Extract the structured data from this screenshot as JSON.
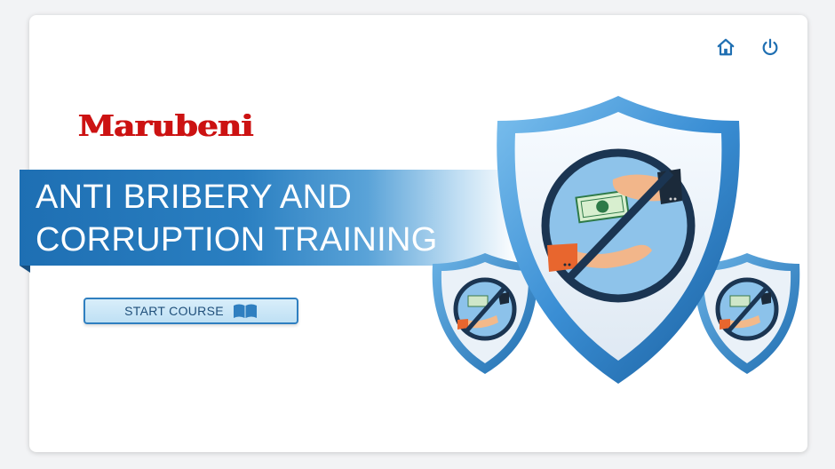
{
  "brand": {
    "name": "Marubeni",
    "color": "#cc1212"
  },
  "header": {
    "icons": [
      {
        "name": "home-icon"
      },
      {
        "name": "power-icon"
      }
    ]
  },
  "banner": {
    "title_line1": "ANTI BRIBERY AND",
    "title_line2": "CORRUPTION TRAINING",
    "color": "#1e6fb3"
  },
  "start": {
    "label": "START COURSE",
    "icon": "open-book-icon"
  },
  "illustration": {
    "description_icon": "no-bribery-shield"
  },
  "colors": {
    "accent": "#2f7fc0",
    "shield_blue": "#3a8ed4",
    "prohibit": "#1b3552"
  }
}
